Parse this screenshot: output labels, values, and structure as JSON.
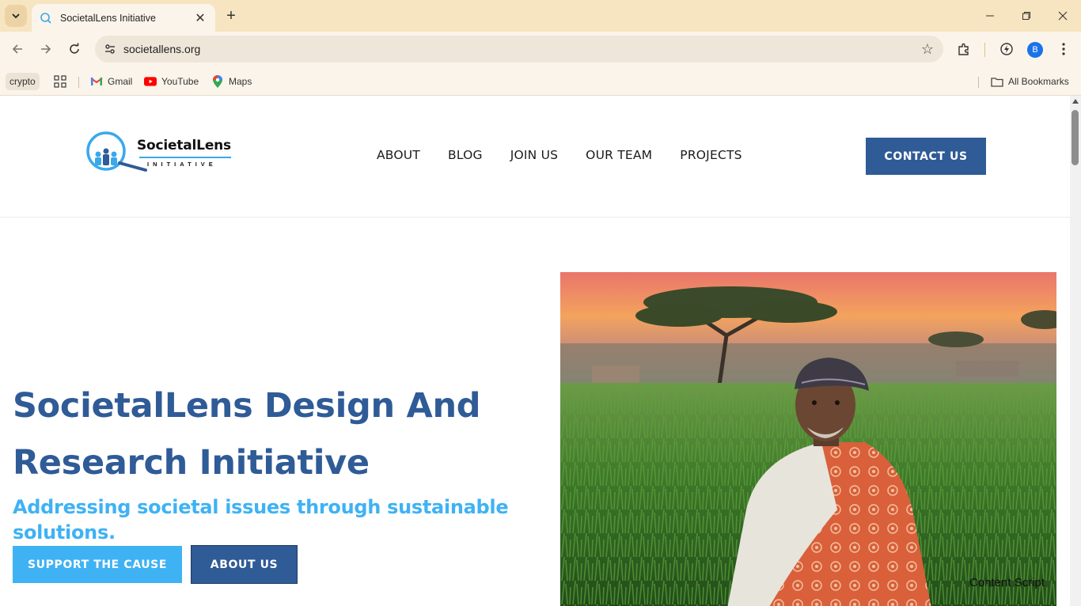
{
  "browser": {
    "tab_title": "SocietalLens Initiative",
    "url": "societallens.org",
    "avatar_letter": "B",
    "bookmarks": {
      "crypto": "crypto",
      "gmail": "Gmail",
      "youtube": "YouTube",
      "maps": "Maps",
      "all": "All Bookmarks"
    }
  },
  "site": {
    "logo_text": "SocietalLens",
    "logo_sub": "INITIATIVE",
    "nav": [
      "ABOUT",
      "BLOG",
      "JOIN US",
      "OUR TEAM",
      "PROJECTS"
    ],
    "contact_label": "CONTACT US"
  },
  "hero": {
    "title_line1": "SocietalLens Design And",
    "title_line2": "Research Initiative",
    "subtitle": "Addressing societal issues through sustainable solutions.",
    "support_label": "SUPPORT THE CAUSE",
    "about_label": "ABOUT US"
  },
  "overlay": {
    "content_script": "Content Script"
  },
  "colors": {
    "brand_blue": "#2f5b97",
    "accent_blue": "#3fb2f4",
    "chrome_bg": "#f7e4c0"
  }
}
